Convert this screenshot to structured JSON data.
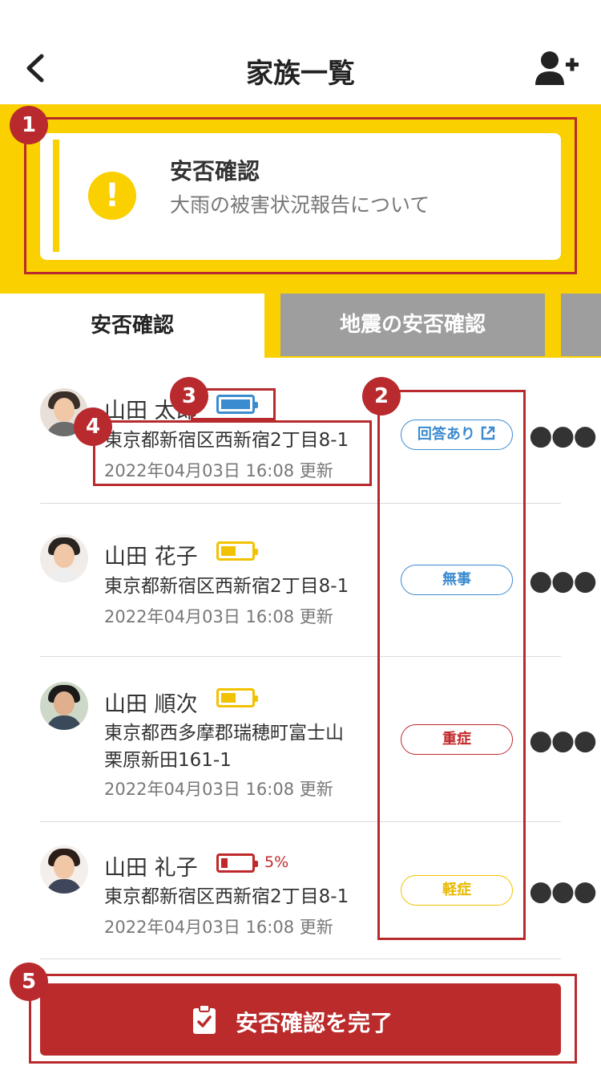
{
  "header": {
    "title": "家族一覧"
  },
  "alert": {
    "title": "安否確認",
    "subtitle": "大雨の被害状況報告について",
    "icon": "!"
  },
  "tabs": [
    {
      "label": "安否確認"
    },
    {
      "label": "地震の安否確認"
    }
  ],
  "members": [
    {
      "name": "山田 太郎",
      "address": "東京都新宿区西新宿2丁目8-1",
      "updated": "2022年04月03日 16:08 更新",
      "status": "回答あり",
      "battery_level": 1.0,
      "battery_color": "#3b8bd0"
    },
    {
      "name": "山田 花子",
      "address": "東京都新宿区西新宿2丁目8-1",
      "updated": "2022年04月03日 16:08 更新",
      "status": "無事",
      "battery_level": 0.5,
      "battery_color": "#f2c200"
    },
    {
      "name": "山田 順次",
      "address": "東京都西多摩郡瑞穂町富士山",
      "address2": "栗原新田161-1",
      "updated": "2022年04月03日 16:08 更新",
      "status": "重症",
      "battery_level": 0.5,
      "battery_color": "#f2c200"
    },
    {
      "name": "山田 礼子",
      "address": "東京都新宿区西新宿2丁目8-1",
      "updated": "2022年04月03日 16:08 更新",
      "status": "軽症",
      "battery_level": 0.05,
      "battery_color": "#c0282b",
      "battery_percent": "5%"
    }
  ],
  "annotations": [
    "1",
    "2",
    "3",
    "4",
    "5"
  ],
  "complete_button": {
    "label": "安否確認を完了"
  },
  "colors": {
    "yellow": "#fad000",
    "red": "#bb2b2b",
    "blue": "#3b8bd0",
    "gray_tab": "#9e9e9e"
  }
}
